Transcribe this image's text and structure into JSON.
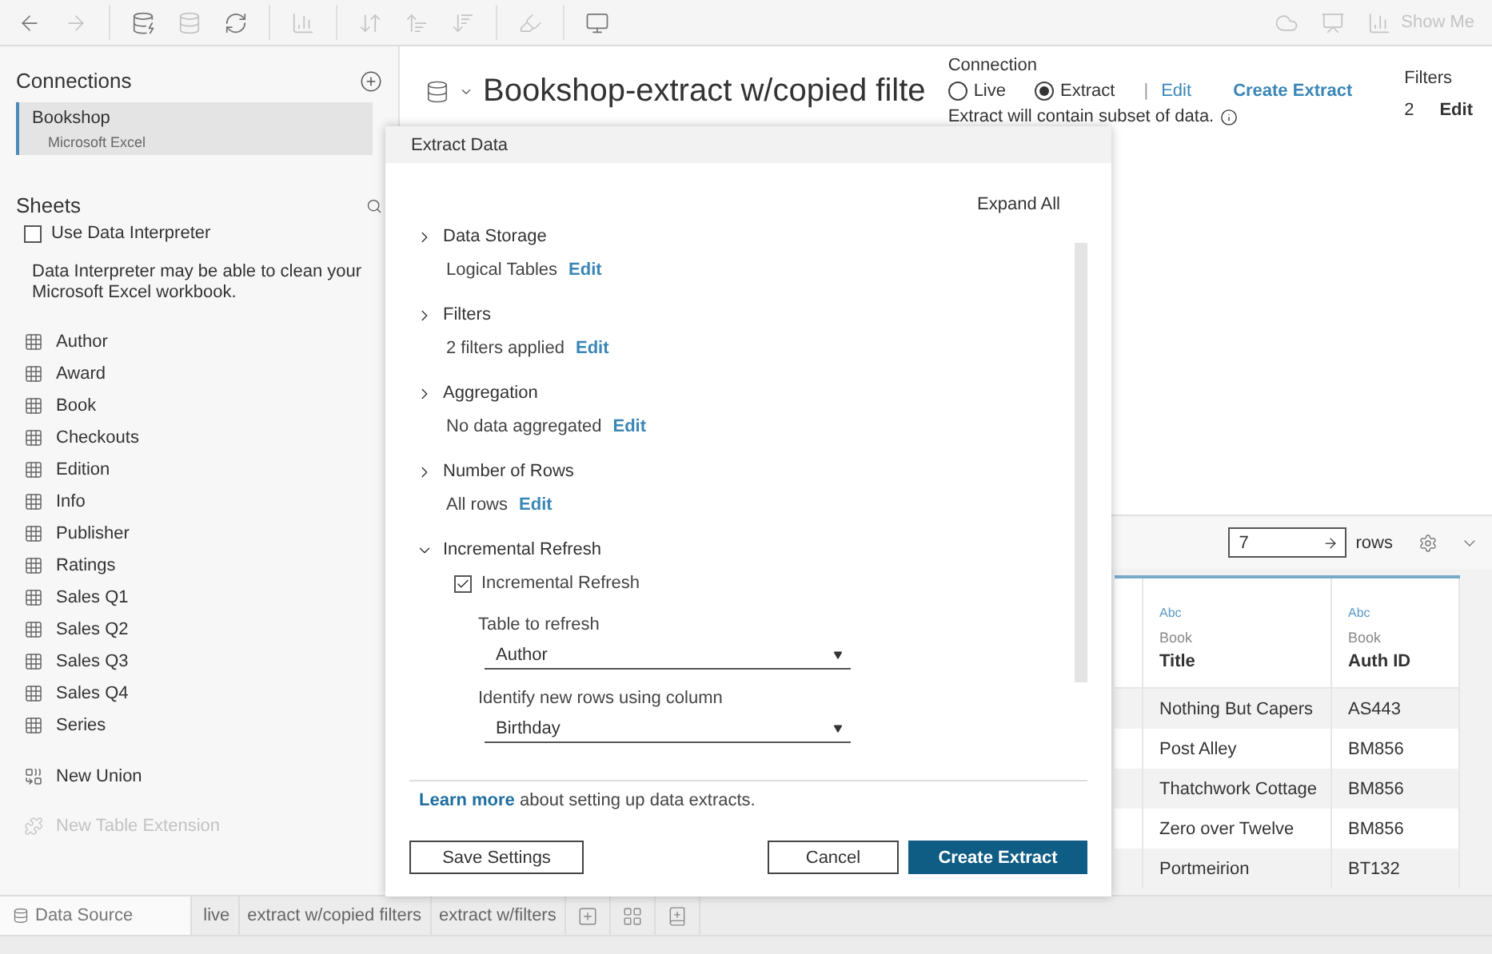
{
  "toolbar": {
    "show_me": "Show Me"
  },
  "connections": {
    "title": "Connections",
    "items": [
      {
        "name": "Bookshop",
        "type": "Microsoft Excel",
        "selected": true
      }
    ]
  },
  "sheets": {
    "title": "Sheets",
    "use_data_interpreter": {
      "label": "Use Data Interpreter",
      "checked": false
    },
    "note": "Data Interpreter may be able to clean your Microsoft Excel workbook.",
    "items": [
      "Author",
      "Award",
      "Book",
      "Checkouts",
      "Edition",
      "Info",
      "Publisher",
      "Ratings",
      "Sales Q1",
      "Sales Q2",
      "Sales Q3",
      "Sales Q4",
      "Series"
    ],
    "new_union": "New Union",
    "new_table_extension": {
      "label": "New Table Extension",
      "disabled": true
    }
  },
  "data_source": {
    "title": "Bookshop-extract w/copied filte",
    "connection": {
      "label": "Connection",
      "options": [
        {
          "label": "Live",
          "selected": false
        },
        {
          "label": "Extract",
          "selected": true
        }
      ],
      "separator": "|",
      "edit": "Edit",
      "create_extract": "Create Extract",
      "note": "Extract will contain subset of data."
    },
    "filters": {
      "label": "Filters",
      "count": "2",
      "edit": "Edit"
    }
  },
  "grid": {
    "rows_value": "7",
    "rows_label": "rows",
    "columns": [
      {
        "type": "Abc",
        "table": "Book",
        "name": "Title"
      },
      {
        "type": "Abc",
        "table": "Book",
        "name": "Auth ID"
      }
    ],
    "rows": [
      [
        "Nothing But Capers",
        "AS443"
      ],
      [
        "Post Alley",
        "BM856"
      ],
      [
        "Thatchwork Cottage",
        "BM856"
      ],
      [
        "Zero over Twelve",
        "BM856"
      ],
      [
        "Portmeirion",
        "BT132"
      ]
    ]
  },
  "dialog": {
    "title": "Extract Data",
    "expand_all": "Expand All",
    "sections": [
      {
        "title": "Data Storage",
        "expanded": false,
        "summary": "Logical Tables",
        "edit": "Edit"
      },
      {
        "title": "Filters",
        "expanded": false,
        "summary": "2 filters applied",
        "edit": "Edit"
      },
      {
        "title": "Aggregation",
        "expanded": false,
        "summary": "No data aggregated",
        "edit": "Edit"
      },
      {
        "title": "Number of Rows",
        "expanded": false,
        "summary": "All rows",
        "edit": "Edit"
      },
      {
        "title": "Incremental Refresh",
        "expanded": true,
        "checkbox": {
          "label": "Incremental Refresh",
          "checked": true
        },
        "fields": [
          {
            "label": "Table to refresh",
            "value": "Author"
          },
          {
            "label": "Identify new rows using column",
            "value": "Birthday"
          }
        ]
      }
    ],
    "help": {
      "link": "Learn more",
      "text": "about setting up data extracts."
    },
    "buttons": [
      {
        "label": "Save Settings",
        "kind": "secondary"
      },
      {
        "label": "Cancel",
        "kind": "secondary"
      },
      {
        "label": "Create Extract",
        "kind": "primary"
      }
    ]
  },
  "bottom_tabs": [
    {
      "label": "Data Source",
      "kind": "source",
      "selected": true
    },
    {
      "label": "live",
      "kind": "sheet",
      "selected": false
    },
    {
      "label": "extract w/copied filters",
      "kind": "sheet",
      "selected": false
    },
    {
      "label": "extract w/filters",
      "kind": "sheet",
      "selected": false
    }
  ]
}
